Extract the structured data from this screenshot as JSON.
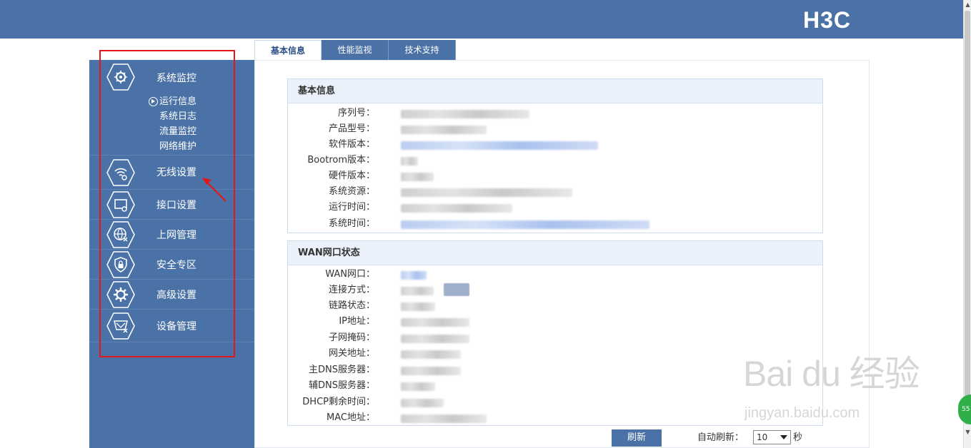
{
  "header": {
    "brand": "H3C",
    "brand_color": "#4b72a6"
  },
  "sidebar": {
    "groups": [
      {
        "label": "系统监控",
        "icon": "monitor-gear-icon",
        "sub_items": [
          "运行信息",
          "系统日志",
          "流量监控",
          "网络维护"
        ],
        "active_sub": "运行信息"
      },
      {
        "label": "无线设置",
        "icon": "wifi-gear-icon"
      },
      {
        "label": "接口设置",
        "icon": "interface-gear-icon"
      },
      {
        "label": "上网管理",
        "icon": "globe-manage-icon"
      },
      {
        "label": "安全专区",
        "icon": "shield-lock-icon"
      },
      {
        "label": "高级设置",
        "icon": "gear-icon"
      },
      {
        "label": "设备管理",
        "icon": "device-manage-icon"
      }
    ]
  },
  "tabs": [
    {
      "label": "基本信息",
      "active": true
    },
    {
      "label": "性能监视",
      "active": false
    },
    {
      "label": "技术支持",
      "active": false
    }
  ],
  "basic_info": {
    "title": "基本信息",
    "rows": [
      "序列号：",
      "产品型号：",
      "软件版本：",
      "Bootrom版本：",
      "硬件版本：",
      "系统资源：",
      "运行时间：",
      "系统时间："
    ]
  },
  "wan_status": {
    "title": "WAN网口状态",
    "rows": [
      "WAN网口：",
      "连接方式：",
      "链路状态：",
      "IP地址：",
      "子网掩码：",
      "网关地址：",
      "主DNS服务器：",
      "辅DNS服务器：",
      "DHCP剩余时间：",
      "MAC地址："
    ]
  },
  "footer": {
    "refresh_button": "刷新",
    "auto_refresh_label": "自动刷新：",
    "auto_refresh_value": "10",
    "unit": "秒"
  },
  "watermark": {
    "big": "Bai du 经验",
    "small": "jingyan.baidu.com"
  },
  "badge": {
    "text": "55"
  }
}
